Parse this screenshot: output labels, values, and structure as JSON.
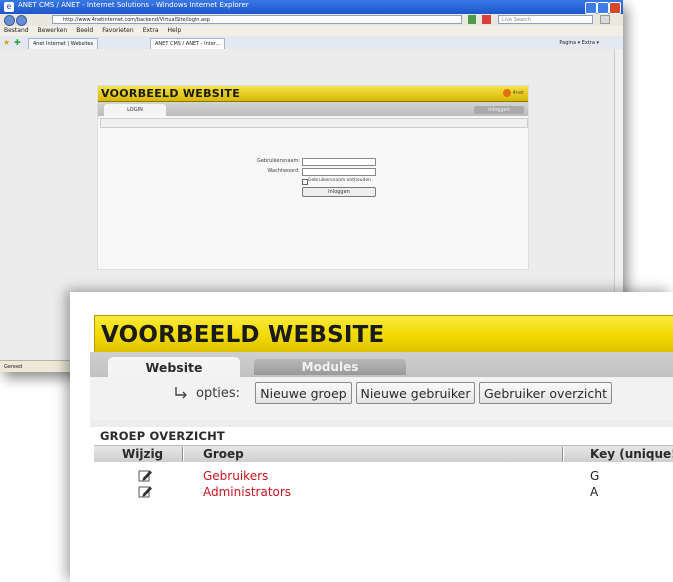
{
  "browser": {
    "window_title": "ANET CMS / ANET - Internet Solutions - Windows Internet Explorer",
    "address": "http://www.4netinternet.com/backend/VirtualSite/login.asp",
    "search_placeholder": "Live Search",
    "menu": [
      "Bestand",
      "Bewerken",
      "Beeld",
      "Favorieten",
      "Extra",
      "Help"
    ],
    "tabs": [
      "4net Internet | Websites",
      "ANET CMS / ANET - Inter..."
    ],
    "toolbar_right": "Pagina ▾   Extra ▾",
    "status": "Gereed"
  },
  "inner_page": {
    "site_title": "VOORBEELD WEBSITE",
    "logo_text": "4net",
    "tab_login": "LOGIN",
    "tab_right": "inloggen",
    "username_label": "Gebruikersnaam:",
    "password_label": "Wachtwoord:",
    "remember_label": "Gebruikersnaam onthouden",
    "login_button": "Inloggen"
  },
  "main": {
    "site_title": "VOORBEELD WEBSITE",
    "tabs": [
      {
        "label": "Website",
        "active": true
      },
      {
        "label": "Modules",
        "active": false
      }
    ],
    "options_label": "opties:",
    "option_buttons": [
      "Nieuwe groep",
      "Nieuwe gebruiker",
      "Gebruiker overzicht"
    ],
    "section_title": "GROEP OVERZICHT",
    "columns": [
      "Wijzig",
      "Groep",
      "Key (unique!)"
    ],
    "rows": [
      {
        "group": "Gebruikers",
        "key": "G"
      },
      {
        "group": "Administrators",
        "key": "A"
      }
    ]
  },
  "colors": {
    "header_yellow": "#f0d800",
    "group_link": "#c8141e",
    "ie_title_blue": "#2a66d8"
  }
}
